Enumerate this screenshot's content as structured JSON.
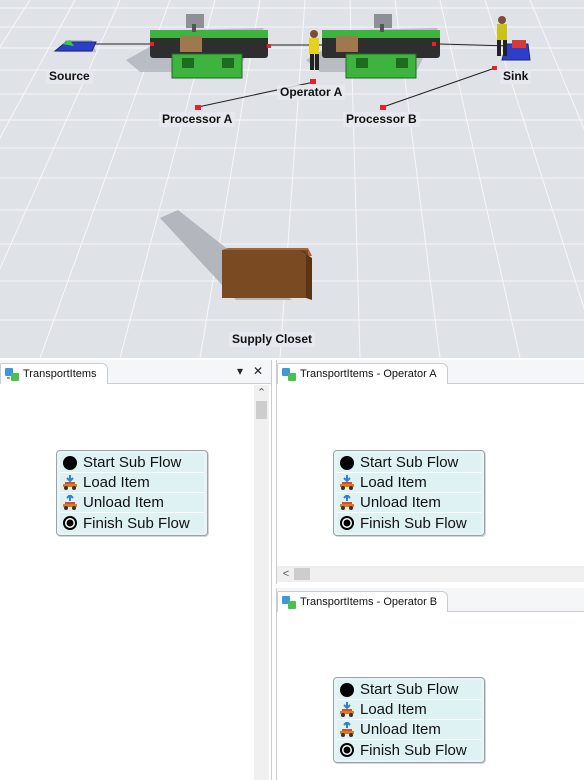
{
  "scene": {
    "labels": {
      "source": "Source",
      "sink": "Sink",
      "operator_a": "Operator A",
      "processor_a": "Processor A",
      "processor_b": "Processor B",
      "supply_closet": "Supply Closet"
    }
  },
  "left_pane": {
    "tab_label": "TransportItems",
    "dropdown_glyph": "▾",
    "close_glyph": "✕",
    "scroll_up_glyph": "⌃"
  },
  "right_top_pane": {
    "tab_label": "TransportItems - Operator A",
    "scroll_left_glyph": "<"
  },
  "right_bottom_pane": {
    "tab_label": "TransportItems - Operator B"
  },
  "activities": {
    "start": "Start Sub Flow",
    "load": "Load Item",
    "unload": "Unload Item",
    "finish": "Finish Sub Flow"
  },
  "colors": {
    "scene_floor": "#dfe2e7",
    "grid_line": "#f4f5f7",
    "conveyor_green": "#3fb33f",
    "box_brown": "#7a4a22",
    "connector_red": "#e8222a",
    "source_blue": "#2d3fc8",
    "flow_box_fill": "#def1f3"
  }
}
